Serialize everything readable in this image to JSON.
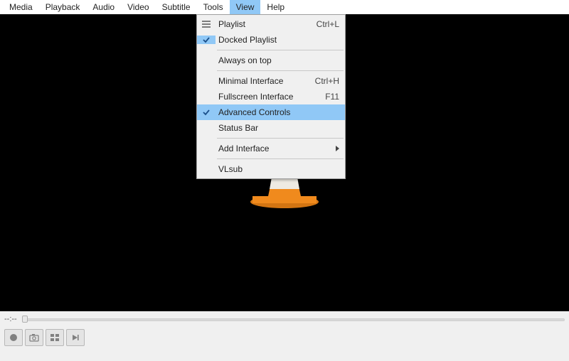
{
  "menubar": {
    "items": [
      {
        "label": "Media"
      },
      {
        "label": "Playback"
      },
      {
        "label": "Audio"
      },
      {
        "label": "Video"
      },
      {
        "label": "Subtitle"
      },
      {
        "label": "Tools"
      },
      {
        "label": "View"
      },
      {
        "label": "Help"
      }
    ],
    "open_index": 6
  },
  "view_menu": {
    "playlist": {
      "label": "Playlist",
      "shortcut": "Ctrl+L"
    },
    "docked_playlist": {
      "label": "Docked Playlist",
      "checked": true
    },
    "always_on_top": {
      "label": "Always on top"
    },
    "minimal_interface": {
      "label": "Minimal Interface",
      "shortcut": "Ctrl+H"
    },
    "fullscreen_interface": {
      "label": "Fullscreen Interface",
      "shortcut": "F11"
    },
    "advanced_controls": {
      "label": "Advanced Controls",
      "checked": true,
      "highlighted": true
    },
    "status_bar": {
      "label": "Status Bar"
    },
    "add_interface": {
      "label": "Add Interface"
    },
    "vlsub": {
      "label": "VLsub"
    }
  },
  "seek": {
    "time": "--:--"
  },
  "colors": {
    "highlight": "#90c8f6",
    "cone_orange": "#f08a1d"
  }
}
